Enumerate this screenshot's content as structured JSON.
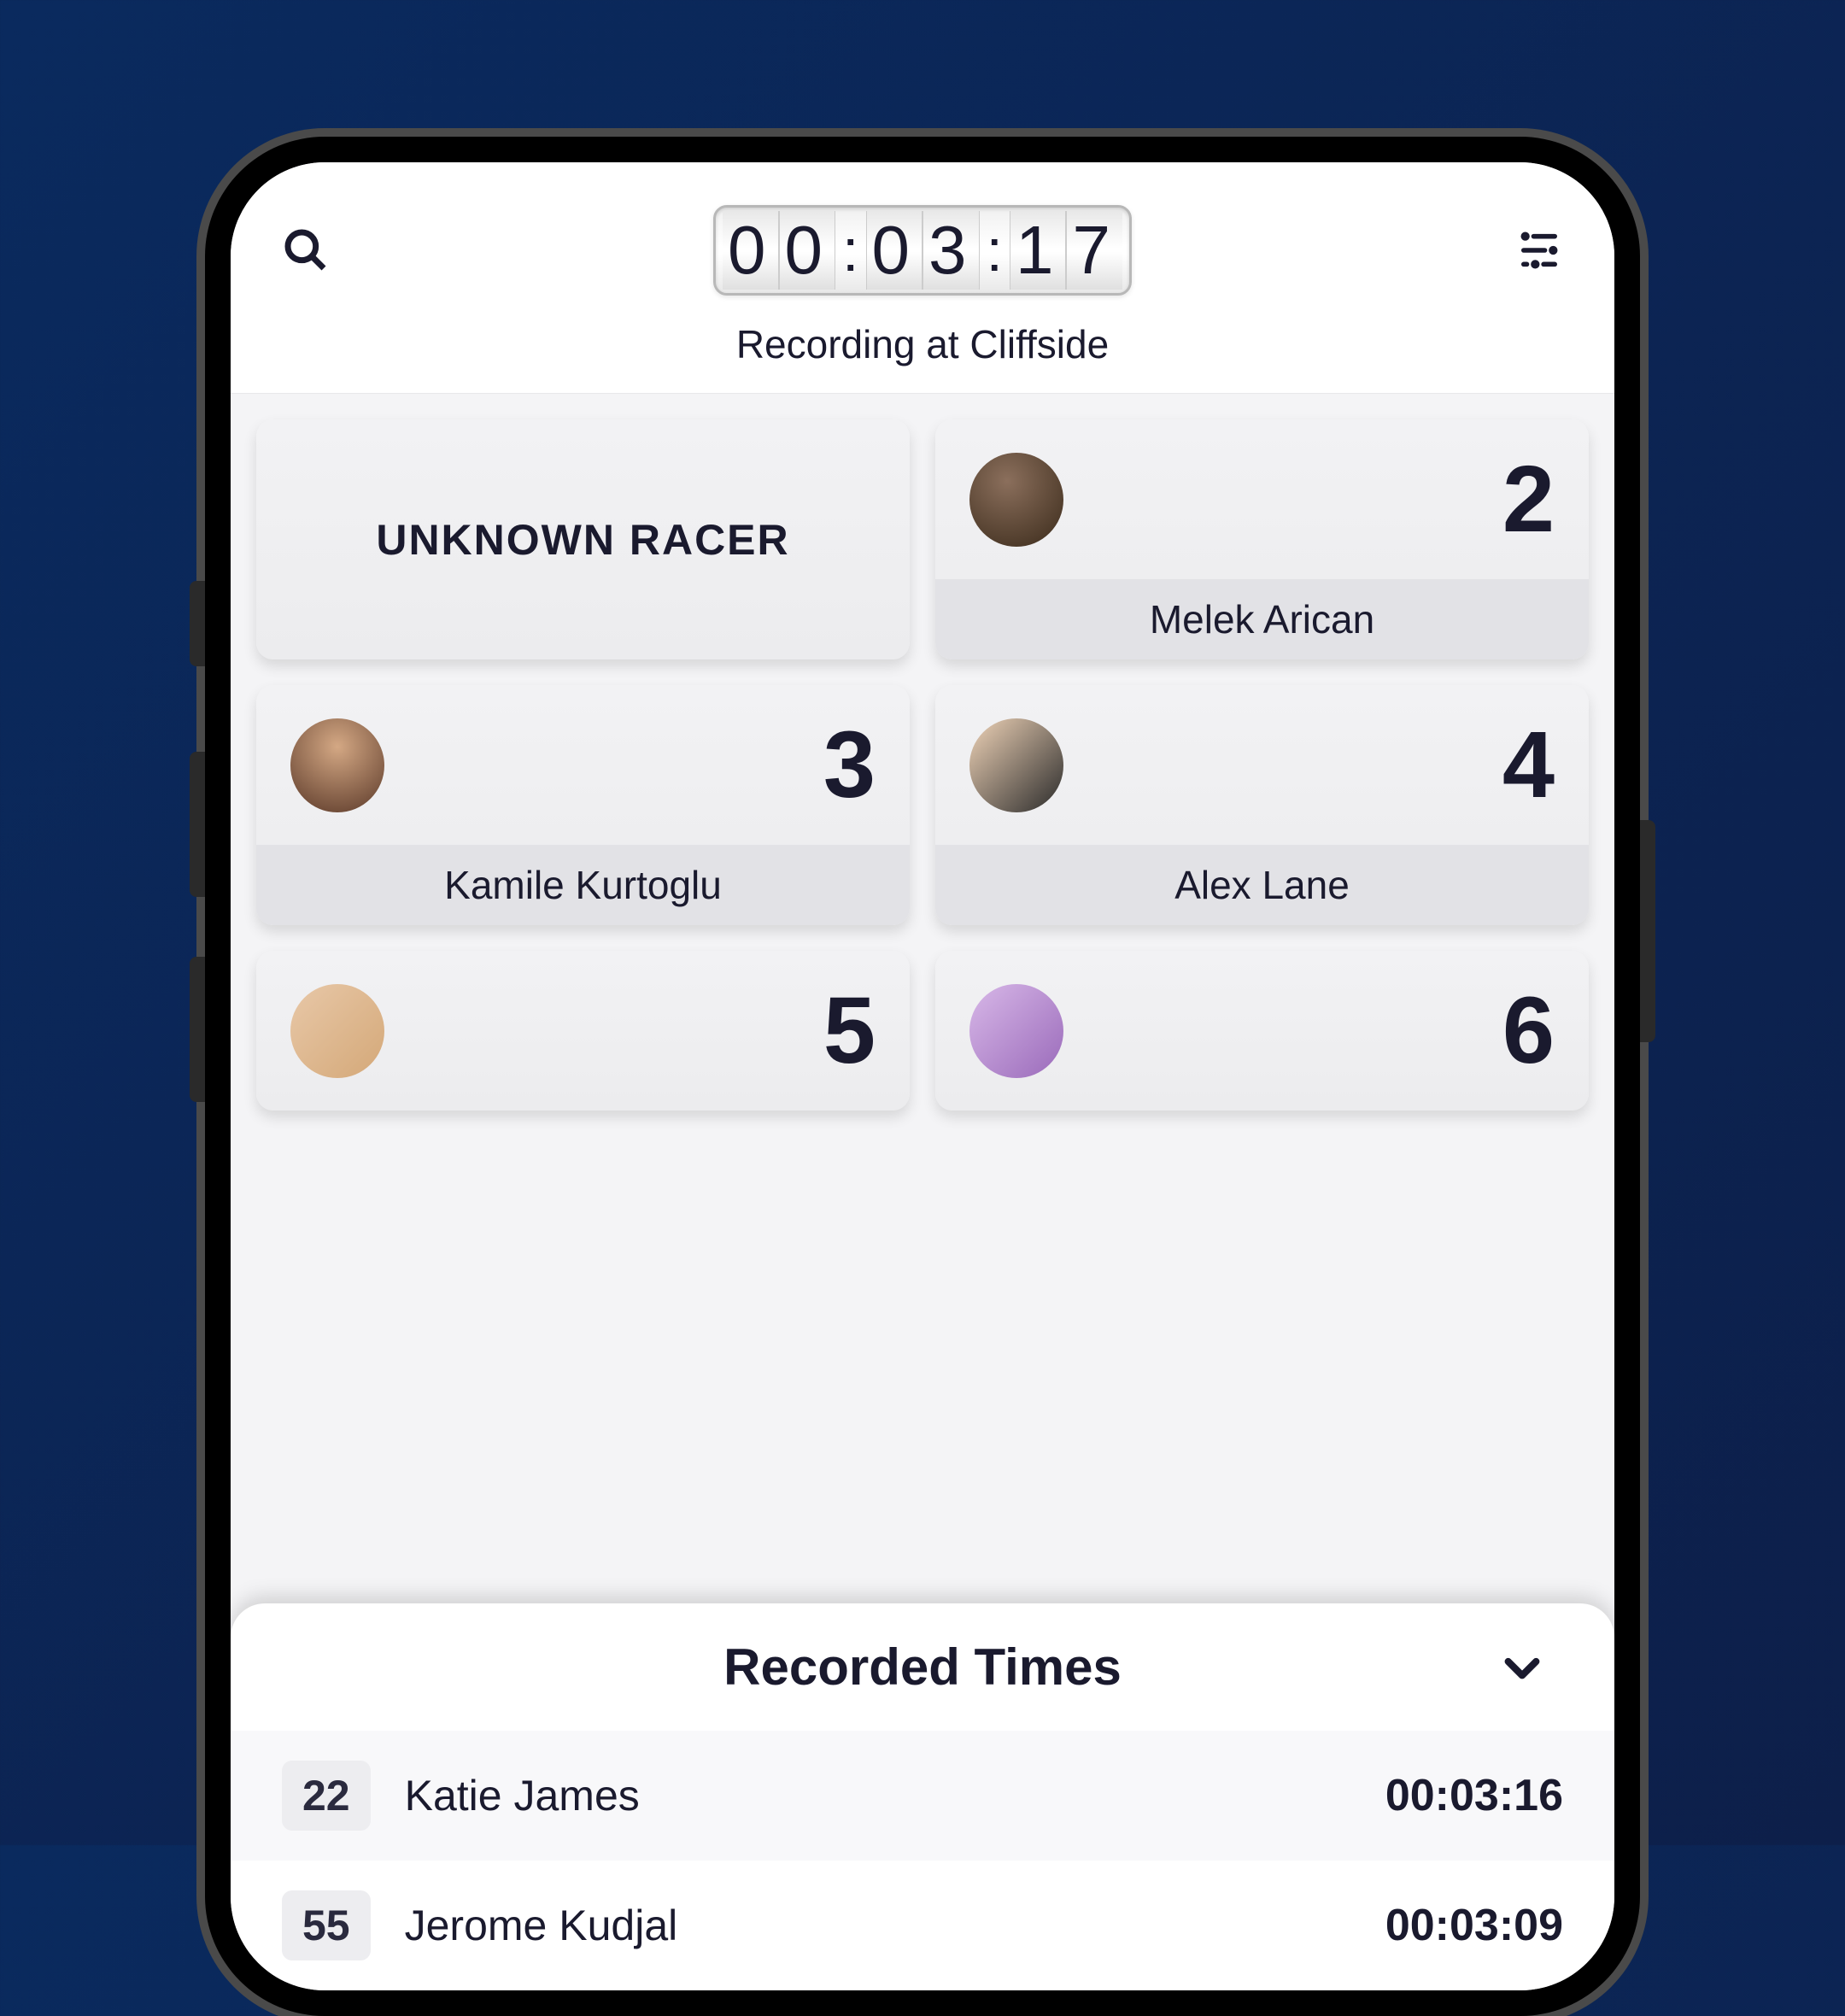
{
  "timer": {
    "d1": "0",
    "d2": "0",
    "d3": "0",
    "d4": "3",
    "d5": "1",
    "d6": "7"
  },
  "header": {
    "recording_label": "Recording at Cliffside"
  },
  "racers": {
    "unknown_label": "UNKNOWN RACER",
    "cards": [
      {
        "number": "2",
        "name": "Melek Arican"
      },
      {
        "number": "3",
        "name": "Kamile Kurtoglu"
      },
      {
        "number": "4",
        "name": "Alex Lane"
      },
      {
        "number": "5",
        "name": ""
      },
      {
        "number": "6",
        "name": ""
      }
    ]
  },
  "recorded": {
    "title": "Recorded Times",
    "rows": [
      {
        "number": "22",
        "name": "Katie James",
        "time": "00:03:16"
      },
      {
        "number": "55",
        "name": "Jerome Kudjal",
        "time": "00:03:09"
      }
    ]
  }
}
